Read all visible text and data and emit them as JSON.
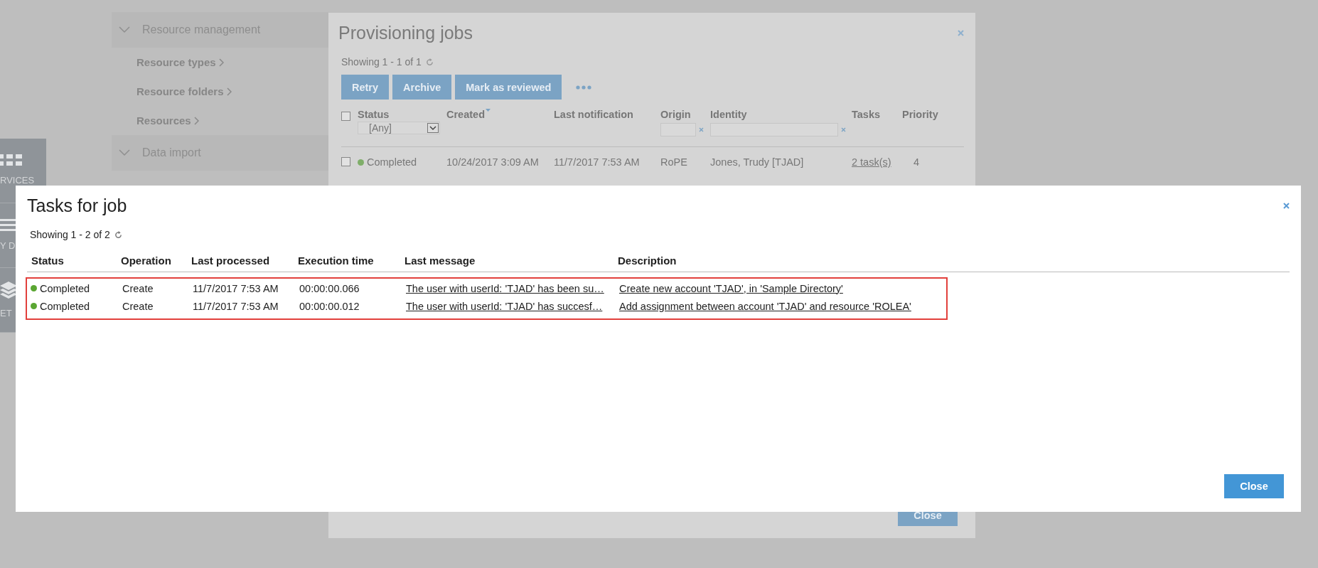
{
  "app_rail": {
    "items": [
      {
        "kind": "grid",
        "label": "RVICES"
      },
      {
        "kind": "lines",
        "label": "Y D"
      },
      {
        "kind": "layers",
        "label": "ET"
      }
    ]
  },
  "side_nav": {
    "sections": [
      {
        "title": "Resource management",
        "expanded": true,
        "items": [
          "Resource types",
          "Resource folders",
          "Resources"
        ]
      },
      {
        "title": "Data import",
        "expanded": true
      }
    ]
  },
  "provisioning_dialog": {
    "title": "Provisioning jobs",
    "showing": "Showing 1 - 1 of 1",
    "buttons": [
      "Retry",
      "Archive",
      "Mark as reviewed"
    ],
    "select_all_checked": false,
    "columns": [
      {
        "label": "Status",
        "kind": "select",
        "sorted": false,
        "filter_value": "[Any]"
      },
      {
        "label": "Created",
        "kind": "plain",
        "sorted": true
      },
      {
        "label": "Last notification",
        "kind": "plain",
        "sorted": false
      },
      {
        "label": "Origin",
        "kind": "text",
        "sorted": false
      },
      {
        "label": "Identity",
        "kind": "text",
        "sorted": false
      },
      {
        "label": "Tasks",
        "kind": "plain",
        "sorted": false
      },
      {
        "label": "Priority",
        "kind": "plain",
        "sorted": false
      }
    ],
    "rows": [
      {
        "checked": false,
        "status": "Completed",
        "color": "#7fae69",
        "created": "10/24/2017 3:09 AM",
        "last_notification": "11/7/2017 7:53 AM",
        "origin": "RoPE",
        "identity": "Jones, Trudy [TJAD]",
        "tasks": "2 task(s)",
        "priority": "4"
      }
    ],
    "close_button": "Close"
  },
  "tasks_dialog": {
    "title": "Tasks for job",
    "showing": "Showing 1 - 2 of 2",
    "columns": [
      "Status",
      "Operation",
      "Last processed",
      "Execution time",
      "Last message",
      "Description"
    ],
    "highlighted": true,
    "rows": [
      {
        "status": "Completed",
        "color": "#5aa632",
        "operation": "Create",
        "last_processed": "11/7/2017 7:53 AM",
        "execution_time": "00:00:00.066",
        "last_message": "The user with userId: 'TJAD' has been su…",
        "description": "Create new account 'TJAD', in 'Sample Directory'"
      },
      {
        "status": "Completed",
        "color": "#5aa632",
        "operation": "Create",
        "last_processed": "11/7/2017 7:53 AM",
        "execution_time": "00:00:00.012",
        "last_message": "The user with userId: 'TJAD' has succesf…",
        "description": "Add assignment between account 'TJAD' and resource 'ROLEA'"
      }
    ],
    "close_button": "Close"
  }
}
